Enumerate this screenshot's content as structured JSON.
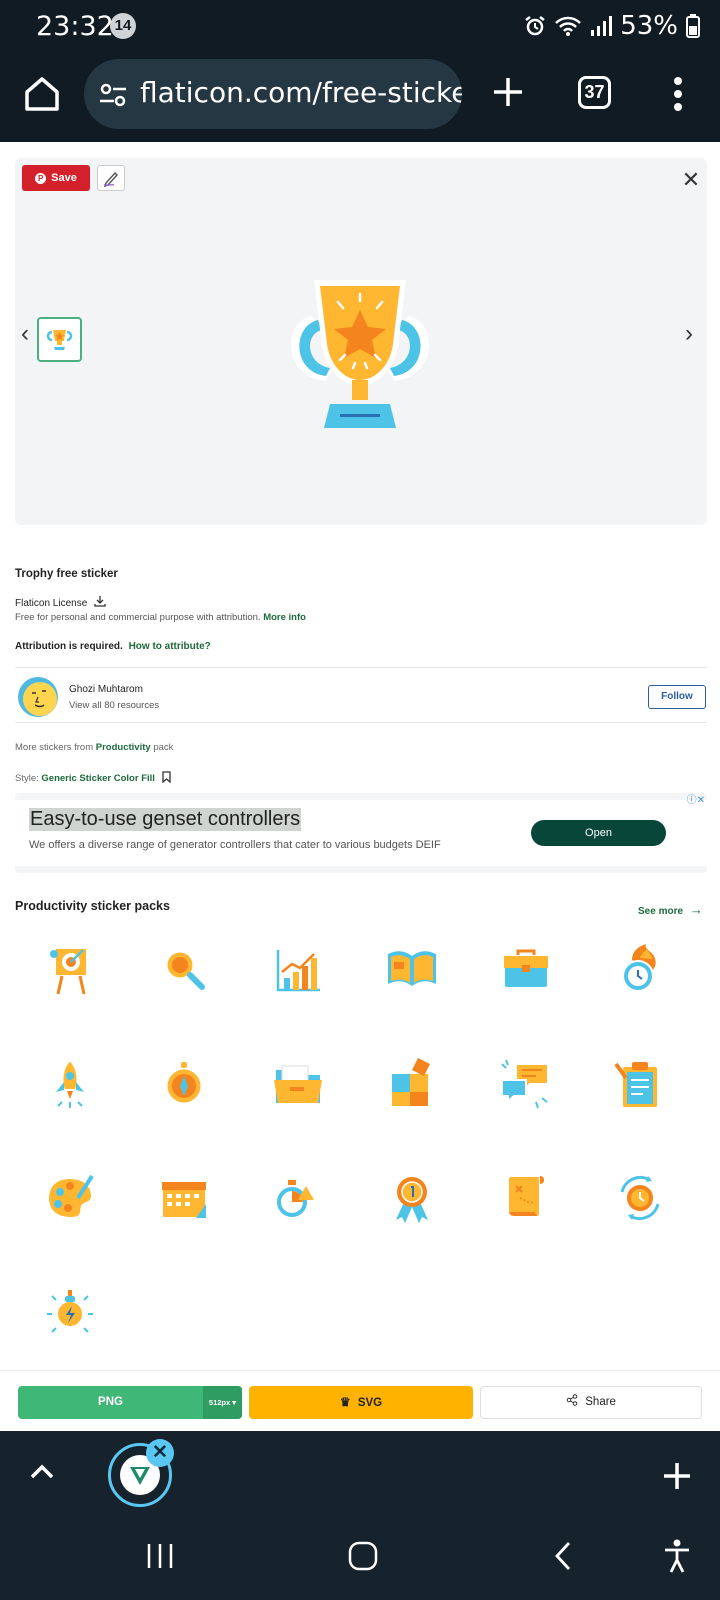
{
  "status_bar": {
    "time": "23:32",
    "notif_count": "14",
    "battery": "53%"
  },
  "browser": {
    "url": "flaticon.com/free-sticker",
    "tab_count": "37"
  },
  "preview": {
    "save_label": "Save",
    "pin_glyph": "P"
  },
  "sticker": {
    "title": "Trophy free sticker",
    "license_label": "Flaticon License",
    "license_desc": "Free for personal and commercial purpose with attribution.",
    "more_info": "More info",
    "attribution_required": "Attribution is required.",
    "how_to_attribute": "How to attribute?"
  },
  "author": {
    "name": "Ghozi Muhtarom",
    "resources": "View all 80 resources",
    "follow_label": "Follow"
  },
  "pack": {
    "more_prefix": "More stickers from",
    "pack_name": "Productivity",
    "more_suffix": "pack",
    "style_prefix": "Style:",
    "style_name": "Generic Sticker Color Fill"
  },
  "ad": {
    "title": "Easy-to-use genset controllers",
    "subtitle": "We offers a diverse range of generator controllers that cater to various budgets DEIF",
    "cta": "Open"
  },
  "packs_section": {
    "title": "Productivity sticker packs",
    "see_more": "See more",
    "stickers": [
      "target-board-icon",
      "magnifier-icon",
      "growth-chart-icon",
      "open-book-icon",
      "briefcase-icon",
      "burning-clock-icon",
      "rocket-icon",
      "compass-icon",
      "folder-icon",
      "puzzle-icon",
      "chat-bubbles-icon",
      "clipboard-icon",
      "palette-icon",
      "calendar-icon",
      "stopwatch-icon",
      "medal-icon",
      "treasure-map-icon",
      "clock-cycle-icon",
      "light-bulb-icon"
    ]
  },
  "download": {
    "png_label": "PNG",
    "png_size": "512px",
    "svg_label": "SVG",
    "share_label": "Share"
  },
  "colors": {
    "accent_green": "#3fb776",
    "svg_yellow": "#ffb200",
    "pinterest_red": "#d4202a",
    "link_green": "#1c6b3c"
  }
}
